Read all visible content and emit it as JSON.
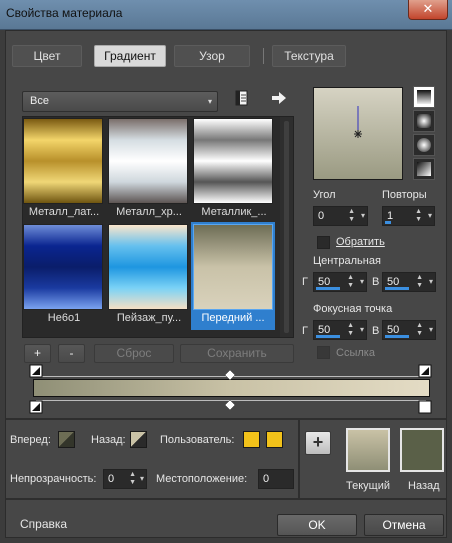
{
  "window": {
    "title": "Свойства материала",
    "close_glyph": "✕"
  },
  "tabs": [
    {
      "label": "Цвет",
      "active": false
    },
    {
      "label": "Градиент",
      "active": true
    },
    {
      "label": "Узор",
      "active": false
    },
    {
      "label": "Текстура",
      "active": false
    }
  ],
  "category": {
    "value": "Все",
    "caret": "▾"
  },
  "icons": {
    "notes": "notes-icon",
    "arrow": "arrow-right-icon"
  },
  "swatches": [
    {
      "label": "Металл_лат...",
      "gradient": [
        "#7a5a12",
        "#f3d56a",
        "#b8902a",
        "#f0d777",
        "#6f5510"
      ],
      "selected": false
    },
    {
      "label": "Металл_хр...",
      "gradient": [
        "#7a6e6a",
        "#d5dde2",
        "#ffffff",
        "#cfd7dd",
        "#5d5553"
      ],
      "selected": false
    },
    {
      "label": "Металлик_...",
      "gradient": [
        "#ffffff",
        "#777777",
        "#ffffff",
        "#555555",
        "#ffffff"
      ],
      "selected": false
    },
    {
      "label": "Не6о1",
      "gradient": [
        "#6f8ed8",
        "#0a2590",
        "#0a1d6a",
        "#1a3aa0",
        "#7aa2f0"
      ],
      "selected": false
    },
    {
      "label": "Пейзаж_пу...",
      "gradient": [
        "#fbe6cc",
        "#65c0ee",
        "#1e96e0",
        "#7ad2f6",
        "#f5dfc4"
      ],
      "selected": false
    },
    {
      "label": "Передний ...",
      "gradient": [
        "#6d6d55",
        "#c9c2a8",
        "#d9d2bc"
      ],
      "selected": true
    }
  ],
  "swatch_actions": {
    "add": "+",
    "remove": "-",
    "reset": "Сброс",
    "save": "Сохранить"
  },
  "angle": {
    "label": "Угол",
    "value": "0"
  },
  "repeats": {
    "label": "Повторы",
    "value": "1"
  },
  "invert": {
    "label": "Обратить",
    "checked": false
  },
  "center": {
    "label": "Центральная",
    "h_label": "Г",
    "h_value": "50",
    "v_label": "В",
    "v_value": "50"
  },
  "focus": {
    "label": "Фокусная точка",
    "h_label": "Г",
    "h_value": "50",
    "v_label": "В",
    "v_value": "50"
  },
  "link": {
    "label": "Ссылка",
    "checked": false
  },
  "stops": {
    "forward_label": "Вперед:",
    "back_label": "Назад:",
    "user_label": "Пользователь:",
    "opacity_label": "Непрозрачность:",
    "opacity_value": "0",
    "position_label": "Местоположение:",
    "position_value": "0",
    "user_color": "#f2c21a"
  },
  "materials": {
    "add": "+",
    "current_label": "Текущий",
    "back_label": "Назад",
    "current_color": "#c9c2a6",
    "back_color": "#5a6048"
  },
  "footer": {
    "help": "Справка",
    "ok": "OK",
    "cancel": "Отмена"
  },
  "colors": {
    "accent": "#2f7fce",
    "gradient_start": "#8f8f76",
    "gradient_end": "#e4dcc5"
  }
}
